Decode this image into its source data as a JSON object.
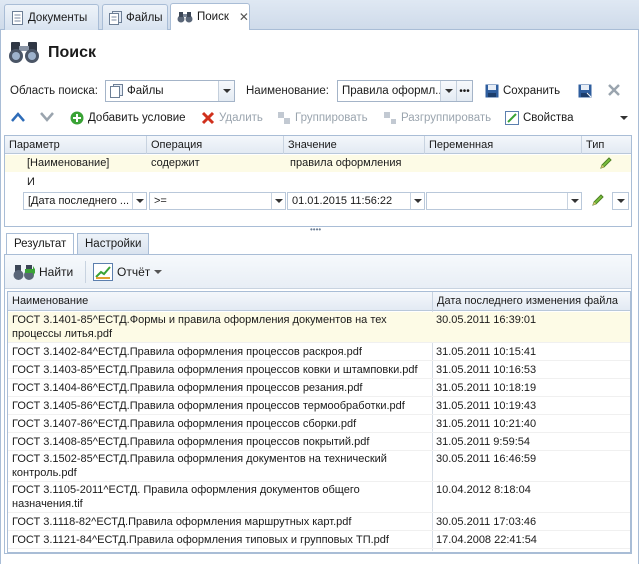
{
  "tabs": [
    {
      "label": "Документы",
      "icon": "document-icon"
    },
    {
      "label": "Файлы",
      "icon": "files-icon"
    },
    {
      "label": "Поиск",
      "icon": "binoculars-icon"
    }
  ],
  "header": {
    "title": "Поиск"
  },
  "search_area": {
    "label": "Область поиска:",
    "value": "Файлы"
  },
  "name_field": {
    "label": "Наименование:",
    "value": "Правила оформл..."
  },
  "save_label": "Сохранить",
  "toolbar": {
    "add_condition": "Добавить условие",
    "delete": "Удалить",
    "group": "Группировать",
    "ungroup": "Разгруппировать",
    "properties": "Свойства"
  },
  "grid": {
    "columns": [
      "Параметр",
      "Операция",
      "Значение",
      "Переменная",
      "Тип"
    ],
    "rows": [
      {
        "param": "[Наименование]",
        "op": "содержит",
        "value": "правила оформления"
      },
      {
        "conj": "И"
      },
      {
        "param": "[Дата последнего ...",
        "op": ">=",
        "value": "01.01.2015 11:56:22"
      }
    ]
  },
  "result_tabs": [
    "Результат",
    "Настройки"
  ],
  "result_toolbar": {
    "find": "Найти",
    "report": "Отчёт"
  },
  "results": {
    "columns": [
      "Наименование",
      "Дата последнего изменения файла"
    ],
    "rows": [
      {
        "name": "ГОСТ 3.1401-85^ЕСТД.Формы и правила оформления документов на тех процессы литья.pdf",
        "date": "30.05.2011 16:39:01"
      },
      {
        "name": "ГОСТ 3.1402-84^ЕСТД.Правила оформления процессов раскроя.pdf",
        "date": "31.05.2011 10:15:41"
      },
      {
        "name": "ГОСТ 3.1403-85^ЕСТД.Правила оформления процессов ковки и штамповки.pdf",
        "date": "31.05.2011 10:16:53"
      },
      {
        "name": "ГОСТ 3.1404-86^ЕСТД.Правила оформления процессов резания.pdf",
        "date": "31.05.2011 10:18:19"
      },
      {
        "name": "ГОСТ 3.1405-86^ЕСТД.Правила оформления процессов термообработки.pdf",
        "date": "31.05.2011 10:19:43"
      },
      {
        "name": "ГОСТ 3.1407-86^ЕСТД.Правила оформления процессов сборки.pdf",
        "date": "31.05.2011 10:21:40"
      },
      {
        "name": "ГОСТ 3.1408-85^ЕСТД.Правила оформления процессов покрытий.pdf",
        "date": "31.05.2011 9:59:54"
      },
      {
        "name": "ГОСТ 3.1502-85^ЕСТД.Правила оформления документов на технический контроль.pdf",
        "date": "30.05.2011 16:46:59"
      },
      {
        "name": "ГОСТ 3.1105-2011^ЕСТД. Правила оформления документов общего назначения.tif",
        "date": "10.04.2012 8:18:04"
      },
      {
        "name": "ГОСТ 3.1118-82^ЕСТД.Правила оформления маршрутных карт.pdf",
        "date": "30.05.2011 17:03:46"
      },
      {
        "name": "ГОСТ 3.1121-84^ЕСТД.Правила оформления типовых и групповых ТП.pdf",
        "date": "17.04.2008 22:41:54"
      }
    ]
  }
}
